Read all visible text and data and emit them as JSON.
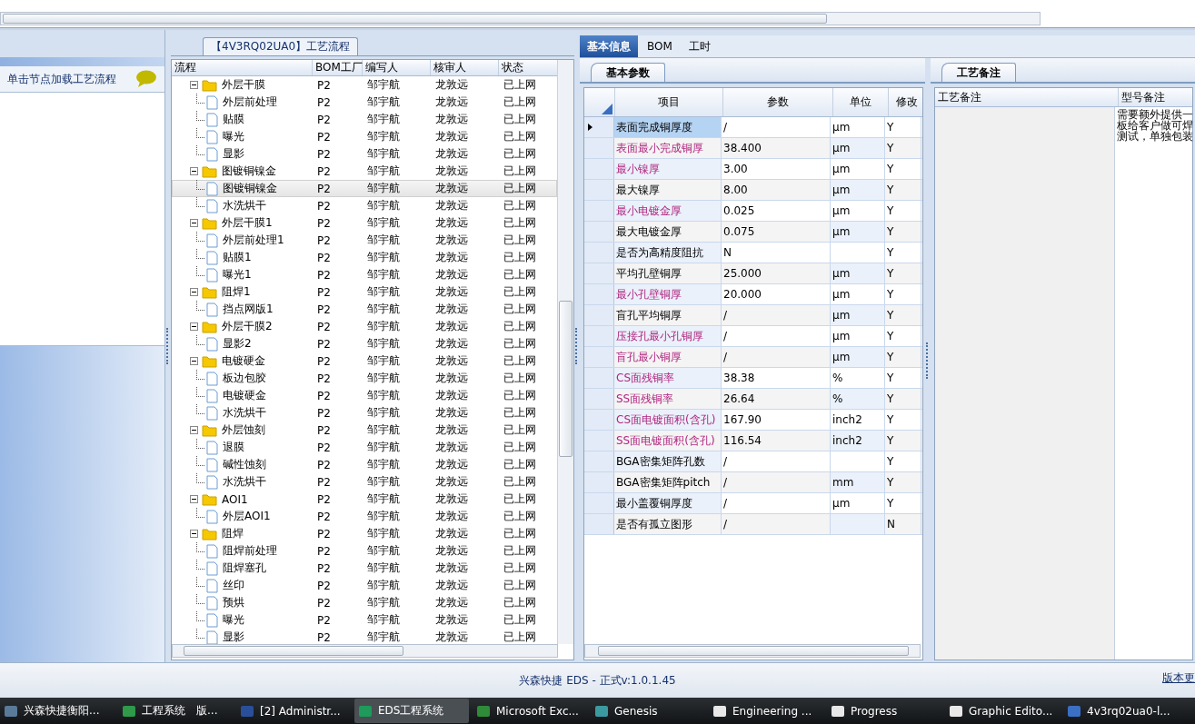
{
  "left_panel": {
    "hint": "单击节点加载工艺流程"
  },
  "process_group": {
    "title": "【4V3RQ02UA0】工艺流程",
    "columns": [
      "流程",
      "BOM工厂",
      "编写人",
      "核审人",
      "状态"
    ],
    "tree": [
      {
        "name": "外层干膜",
        "factory": "P2",
        "writer": "邹宇航",
        "reviewer": "龙敦远",
        "status": "已上网",
        "expanded": true,
        "selected": false,
        "children": [
          {
            "name": "外层前处理",
            "factory": "P2",
            "writer": "邹宇航",
            "reviewer": "龙敦远",
            "status": "已上网",
            "selected": false
          },
          {
            "name": "贴膜",
            "factory": "P2",
            "writer": "邹宇航",
            "reviewer": "龙敦远",
            "status": "已上网",
            "selected": false
          },
          {
            "name": "曝光",
            "factory": "P2",
            "writer": "邹宇航",
            "reviewer": "龙敦远",
            "status": "已上网",
            "selected": false
          },
          {
            "name": "显影",
            "factory": "P2",
            "writer": "邹宇航",
            "reviewer": "龙敦远",
            "status": "已上网",
            "selected": false
          }
        ]
      },
      {
        "name": "图镀铜镍金",
        "factory": "P2",
        "writer": "邹宇航",
        "reviewer": "龙敦远",
        "status": "已上网",
        "expanded": true,
        "selected": false,
        "children": [
          {
            "name": "图镀铜镍金",
            "factory": "P2",
            "writer": "邹宇航",
            "reviewer": "龙敦远",
            "status": "已上网",
            "selected": true
          },
          {
            "name": "水洗烘干",
            "factory": "P2",
            "writer": "邹宇航",
            "reviewer": "龙敦远",
            "status": "已上网",
            "selected": false
          }
        ]
      },
      {
        "name": "外层干膜1",
        "factory": "P2",
        "writer": "邹宇航",
        "reviewer": "龙敦远",
        "status": "已上网",
        "expanded": true,
        "selected": false,
        "children": [
          {
            "name": "外层前处理1",
            "factory": "P2",
            "writer": "邹宇航",
            "reviewer": "龙敦远",
            "status": "已上网",
            "selected": false
          },
          {
            "name": "贴膜1",
            "factory": "P2",
            "writer": "邹宇航",
            "reviewer": "龙敦远",
            "status": "已上网",
            "selected": false
          },
          {
            "name": "曝光1",
            "factory": "P2",
            "writer": "邹宇航",
            "reviewer": "龙敦远",
            "status": "已上网",
            "selected": false
          }
        ]
      },
      {
        "name": "阻焊1",
        "factory": "P2",
        "writer": "邹宇航",
        "reviewer": "龙敦远",
        "status": "已上网",
        "expanded": true,
        "selected": false,
        "children": [
          {
            "name": "挡点网版1",
            "factory": "P2",
            "writer": "邹宇航",
            "reviewer": "龙敦远",
            "status": "已上网",
            "selected": false
          }
        ]
      },
      {
        "name": "外层干膜2",
        "factory": "P2",
        "writer": "邹宇航",
        "reviewer": "龙敦远",
        "status": "已上网",
        "expanded": true,
        "selected": false,
        "children": [
          {
            "name": "显影2",
            "factory": "P2",
            "writer": "邹宇航",
            "reviewer": "龙敦远",
            "status": "已上网",
            "selected": false
          }
        ]
      },
      {
        "name": "电镀硬金",
        "factory": "P2",
        "writer": "邹宇航",
        "reviewer": "龙敦远",
        "status": "已上网",
        "expanded": true,
        "selected": false,
        "children": [
          {
            "name": "板边包胶",
            "factory": "P2",
            "writer": "邹宇航",
            "reviewer": "龙敦远",
            "status": "已上网",
            "selected": false
          },
          {
            "name": "电镀硬金",
            "factory": "P2",
            "writer": "邹宇航",
            "reviewer": "龙敦远",
            "status": "已上网",
            "selected": false
          },
          {
            "name": "水洗烘干",
            "factory": "P2",
            "writer": "邹宇航",
            "reviewer": "龙敦远",
            "status": "已上网",
            "selected": false
          }
        ]
      },
      {
        "name": "外层蚀刻",
        "factory": "P2",
        "writer": "邹宇航",
        "reviewer": "龙敦远",
        "status": "已上网",
        "expanded": true,
        "selected": false,
        "children": [
          {
            "name": "退膜",
            "factory": "P2",
            "writer": "邹宇航",
            "reviewer": "龙敦远",
            "status": "已上网",
            "selected": false
          },
          {
            "name": "碱性蚀刻",
            "factory": "P2",
            "writer": "邹宇航",
            "reviewer": "龙敦远",
            "status": "已上网",
            "selected": false
          },
          {
            "name": "水洗烘干",
            "factory": "P2",
            "writer": "邹宇航",
            "reviewer": "龙敦远",
            "status": "已上网",
            "selected": false
          }
        ]
      },
      {
        "name": "AOI1",
        "factory": "P2",
        "writer": "邹宇航",
        "reviewer": "龙敦远",
        "status": "已上网",
        "expanded": true,
        "selected": false,
        "children": [
          {
            "name": "外层AOI1",
            "factory": "P2",
            "writer": "邹宇航",
            "reviewer": "龙敦远",
            "status": "已上网",
            "selected": false
          }
        ]
      },
      {
        "name": "阻焊",
        "factory": "P2",
        "writer": "邹宇航",
        "reviewer": "龙敦远",
        "status": "已上网",
        "expanded": true,
        "selected": false,
        "children": [
          {
            "name": "阻焊前处理",
            "factory": "P2",
            "writer": "邹宇航",
            "reviewer": "龙敦远",
            "status": "已上网",
            "selected": false
          },
          {
            "name": "阻焊塞孔",
            "factory": "P2",
            "writer": "邹宇航",
            "reviewer": "龙敦远",
            "status": "已上网",
            "selected": false
          },
          {
            "name": "丝印",
            "factory": "P2",
            "writer": "邹宇航",
            "reviewer": "龙敦远",
            "status": "已上网",
            "selected": false
          },
          {
            "name": "预烘",
            "factory": "P2",
            "writer": "邹宇航",
            "reviewer": "龙敦远",
            "status": "已上网",
            "selected": false
          },
          {
            "name": "曝光",
            "factory": "P2",
            "writer": "邹宇航",
            "reviewer": "龙敦远",
            "status": "已上网",
            "selected": false
          },
          {
            "name": "显影",
            "factory": "P2",
            "writer": "邹宇航",
            "reviewer": "龙敦远",
            "status": "已上网",
            "selected": false
          }
        ]
      }
    ]
  },
  "detail_tabs": [
    {
      "label": "基本信息",
      "selected": true
    },
    {
      "label": "BOM",
      "selected": false
    },
    {
      "label": "工时",
      "selected": false
    }
  ],
  "params": {
    "tab": "基本参数",
    "columns": [
      "项目",
      "参数",
      "单位",
      "修改"
    ],
    "rows": [
      {
        "item": "表面完成铜厚度",
        "value": "/",
        "unit": "µm",
        "modify": "Y",
        "highlighted": false,
        "selected": true
      },
      {
        "item": "表面最小完成铜厚",
        "value": "38.400",
        "unit": "µm",
        "modify": "Y",
        "highlighted": true,
        "selected": false
      },
      {
        "item": "最小镍厚",
        "value": "3.00",
        "unit": "µm",
        "modify": "Y",
        "highlighted": true,
        "selected": false
      },
      {
        "item": "最大镍厚",
        "value": "8.00",
        "unit": "µm",
        "modify": "Y",
        "highlighted": false,
        "selected": false
      },
      {
        "item": "最小电镀金厚",
        "value": "0.025",
        "unit": "µm",
        "modify": "Y",
        "highlighted": true,
        "selected": false
      },
      {
        "item": "最大电镀金厚",
        "value": "0.075",
        "unit": "µm",
        "modify": "Y",
        "highlighted": false,
        "selected": false
      },
      {
        "item": "是否为高精度阻抗",
        "value": "N",
        "modify": "Y",
        "highlighted": false,
        "selected": false
      },
      {
        "item": "平均孔壁铜厚",
        "value": "25.000",
        "unit": "µm",
        "modify": "Y",
        "highlighted": false,
        "selected": false
      },
      {
        "item": "最小孔壁铜厚",
        "value": "20.000",
        "unit": "µm",
        "modify": "Y",
        "highlighted": true,
        "selected": false
      },
      {
        "item": "盲孔平均铜厚",
        "value": "/",
        "unit": "µm",
        "modify": "Y",
        "highlighted": false,
        "selected": false
      },
      {
        "item": "压接孔最小孔铜厚",
        "value": "/",
        "unit": "µm",
        "modify": "Y",
        "highlighted": true,
        "selected": false
      },
      {
        "item": "盲孔最小铜厚",
        "value": "/",
        "unit": "µm",
        "modify": "Y",
        "highlighted": true,
        "selected": false
      },
      {
        "item": "CS面残铜率",
        "value": "38.38",
        "unit": "%",
        "modify": "Y",
        "highlighted": true,
        "selected": false
      },
      {
        "item": "SS面残铜率",
        "value": "26.64",
        "unit": "%",
        "modify": "Y",
        "highlighted": true,
        "selected": false
      },
      {
        "item": "CS面电镀面积(含孔)",
        "value": "167.90",
        "unit": "inch2",
        "modify": "Y",
        "highlighted": true,
        "selected": false
      },
      {
        "item": "SS面电镀面积(含孔)",
        "value": "116.54",
        "unit": "inch2",
        "modify": "Y",
        "highlighted": true,
        "selected": false
      },
      {
        "item": "BGA密集矩阵孔数",
        "value": "/",
        "modify": "Y",
        "highlighted": false,
        "selected": false
      },
      {
        "item": "BGA密集矩阵pitch",
        "value": "/",
        "unit": "mm",
        "modify": "Y",
        "highlighted": false,
        "selected": false
      },
      {
        "item": "最小盖覆铜厚度",
        "value": "/",
        "unit": "µm",
        "modify": "Y",
        "highlighted": false,
        "selected": false
      },
      {
        "item": "是否有孤立图形",
        "value": "/",
        "modify": "N",
        "highlighted": false,
        "selected": false
      }
    ]
  },
  "notes": {
    "tab": "工艺备注",
    "columns": [
      "工艺备注",
      "型号备注"
    ],
    "model_note_lines": [
      "需要额外提供一",
      "板给客户做可焊",
      "测试，单独包装"
    ]
  },
  "status_bar": {
    "text": "兴森快捷 EDS - 正式v:1.0.1.45",
    "link": "版本更"
  },
  "taskbar": [
    {
      "label": "兴森快捷衡阳...",
      "selected": false
    },
    {
      "label": "工程系统　版...",
      "selected": false
    },
    {
      "label": "[2] Administr...",
      "selected": false
    },
    {
      "label": "EDS工程系统",
      "selected": true
    },
    {
      "label": "Microsoft Exc...",
      "selected": false
    },
    {
      "label": "Genesis",
      "selected": false
    },
    {
      "label": "Engineering ...",
      "selected": false
    },
    {
      "label": "Progress",
      "selected": false
    },
    {
      "label": "Graphic Edito...",
      "selected": false
    },
    {
      "label": "4v3rq02ua0-l...",
      "selected": false
    }
  ]
}
